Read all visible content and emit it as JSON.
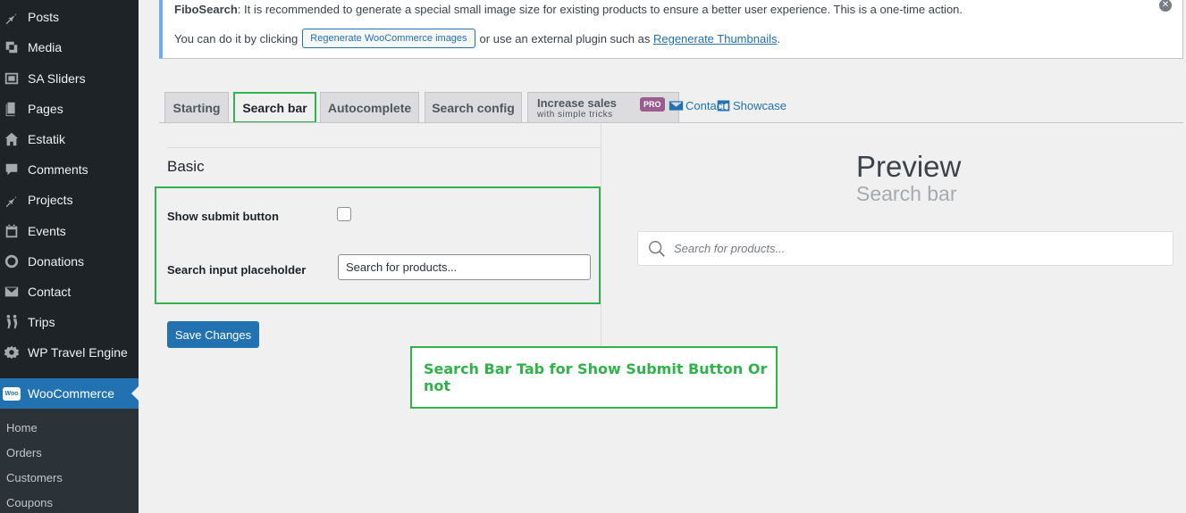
{
  "sidebar": {
    "items": [
      {
        "label": "Posts",
        "icon": "pin-icon"
      },
      {
        "label": "Media",
        "icon": "media-icon"
      },
      {
        "label": "SA Sliders",
        "icon": "slides-icon"
      },
      {
        "label": "Pages",
        "icon": "pages-icon"
      },
      {
        "label": "Estatik",
        "icon": "home-icon"
      },
      {
        "label": "Comments",
        "icon": "comment-icon"
      },
      {
        "label": "Projects",
        "icon": "pin-icon"
      },
      {
        "label": "Events",
        "icon": "calendar-icon"
      },
      {
        "label": "Donations",
        "icon": "donation-icon"
      },
      {
        "label": "Contact",
        "icon": "mail-icon"
      },
      {
        "label": "Trips",
        "icon": "hikers-icon"
      },
      {
        "label": "WP Travel Engine",
        "icon": "gear-icon"
      },
      {
        "label": "WooCommerce",
        "icon": "woo-icon",
        "logo_text": "Woo"
      }
    ],
    "submenu": [
      "Home",
      "Orders",
      "Customers",
      "Coupons"
    ]
  },
  "notice": {
    "brand": "FiboSearch",
    "line1": ": It is recommended to generate a special small image size for existing products to ensure a better user experience. This is a one-time action.",
    "line2_prefix": "You can do it by clicking",
    "button_label": "Regenerate WooCommerce images",
    "line2_mid": "or use an external plugin such as",
    "link_label": "Regenerate Thumbnails",
    "line2_suffix": ".",
    "dismiss": "✕"
  },
  "tabs": {
    "starting": "Starting",
    "search_bar": "Search bar",
    "autocomplete": "Autocomplete",
    "search_config": "Search config",
    "increase_sales": "Increase sales",
    "increase_sales_sub": "with simple tricks",
    "pro_badge": "PRO",
    "contact": "Contact",
    "showcase": "Showcase"
  },
  "settings": {
    "section_title": "Basic",
    "show_submit_label": "Show submit button",
    "show_submit_checked": false,
    "placeholder_label": "Search input placeholder",
    "placeholder_value": "Search for products...",
    "save_button": "Save Changes"
  },
  "annotation": {
    "text": "Search Bar Tab for Show Submit Button Or not",
    "color": "#2fb34a"
  },
  "preview": {
    "title": "Preview",
    "subtitle": "Search bar",
    "search_placeholder": "Search for products..."
  },
  "colors": {
    "accent": "#2271b1",
    "sidebar_bg": "#1d2327",
    "highlight": "#2fb34a"
  }
}
